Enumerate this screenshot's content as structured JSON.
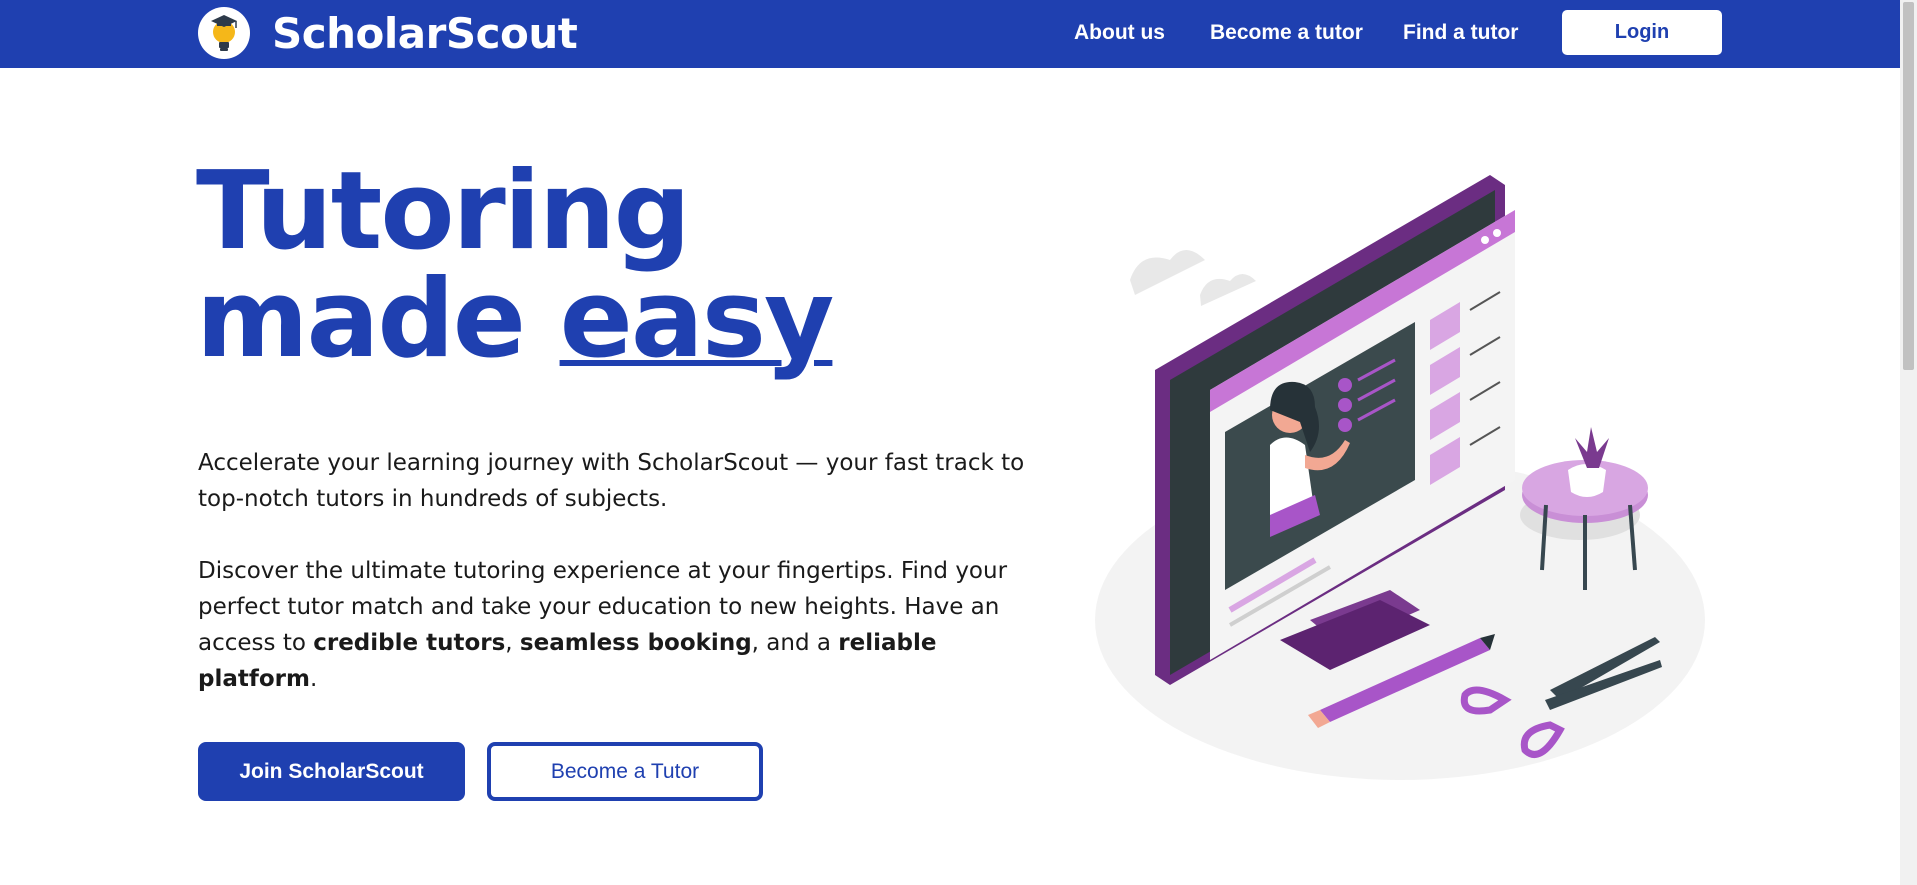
{
  "header": {
    "brand": "ScholarScout",
    "logo_icon": "lightbulb-graduate-icon",
    "nav": [
      {
        "label": "About us"
      },
      {
        "label": "Become a tutor"
      },
      {
        "label": "Find a tutor"
      }
    ],
    "login_label": "Login"
  },
  "hero": {
    "title_line1": "Tutoring",
    "title_line2_prefix": "made ",
    "title_line2_emphasis": "easy",
    "paragraph1": "Accelerate your learning journey with ScholarScout — your fast track to top-notch tutors in hundreds of subjects.",
    "paragraph2": {
      "line1": "Discover the ultimate tutoring experience at your fingertips. Find your",
      "line2": "perfect tutor match and take your education to new heights. Have an access to ",
      "bold1": "credible tutors",
      "sep1": ", ",
      "bold2": "seamless booking",
      "sep2": ", and a ",
      "bold3": "reliable platform",
      "end": "."
    },
    "primary_button": "Join ScholarScout",
    "secondary_button": "Become a Tutor",
    "illustration_icon": "online-tutoring-illustration"
  },
  "colors": {
    "brand_blue": "#1f40b0",
    "accent_purple": "#a855c8",
    "dark_purple": "#6b2d82"
  }
}
